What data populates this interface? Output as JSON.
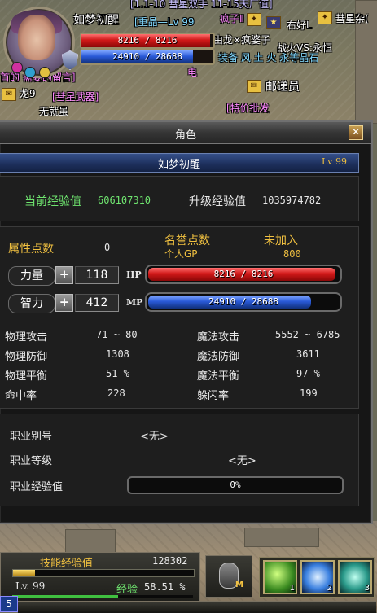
{
  "world": {
    "overhead_texts": [
      {
        "id": "guild_top",
        "text": "[1.1-10  彗星双手  11-15天厂值]",
        "cls": "npc-guild"
      },
      {
        "id": "shop_title1",
        "text": "[重晶—Lv 99",
        "cls": "npc-shop"
      },
      {
        "id": "mad_lady_line",
        "text": "疯子Ⅱ",
        "cls": "npc-title"
      },
      {
        "id": "right_good",
        "text": "右好L",
        "cls": "npc-name"
      },
      {
        "id": "comet_misc",
        "text": "彗星杂(",
        "cls": "npc-name"
      },
      {
        "id": "mad_lady",
        "text": "由龙×疯婆子",
        "cls": "npc-name"
      },
      {
        "id": "war_vs",
        "text": "战火VS:永恒",
        "cls": "npc-name"
      },
      {
        "id": "shop_items",
        "text": "装备  风  土  火  永等晶石",
        "cls": "npc-shop"
      },
      {
        "id": "message_board",
        "text": "首的   需要的留言]",
        "cls": "npc-title"
      },
      {
        "id": "electric",
        "text": "电 ",
        "cls": "npc-title"
      },
      {
        "id": "dragon9",
        "text": "龙9",
        "cls": "npc-name"
      },
      {
        "id": "comet_weapon",
        "text": "[彗星武器]",
        "cls": "npc-title"
      },
      {
        "id": "postman",
        "text": "邮递员",
        "cls": "npc-name"
      },
      {
        "id": "sale",
        "text": "[特价批发",
        "cls": "npc-title"
      },
      {
        "id": "no_shop",
        "text": "无就虽",
        "cls": "npc-name"
      }
    ]
  },
  "player": {
    "name": "如梦初醒",
    "hp_text": "8216 / 8216",
    "mp_text": "24910 / 28688",
    "hp_fraction": 1.0,
    "mp_fraction": 0.868
  },
  "window": {
    "title": "角色",
    "close_glyph": "✕",
    "char_name": "如梦初醒",
    "level": "Lv 99",
    "exp": {
      "current_label": "当前经验值",
      "current_value": "606107310",
      "next_label": "升级经验值",
      "next_value": "1035974782"
    },
    "points": {
      "attr_label": "属性点数",
      "attr_value": "0",
      "honor_label": "名誉点数",
      "honor_sub": "个人GP",
      "status_label": "未加入",
      "gp_value": "800"
    },
    "str": {
      "label": "力量",
      "value": "118",
      "bar_tag": "HP",
      "bar_text": "8216 / 8216",
      "fraction": 1.0
    },
    "int": {
      "label": "智力",
      "value": "412",
      "bar_tag": "MP",
      "bar_text": "24910 / 28688",
      "fraction": 0.868
    },
    "plus_glyph": "+",
    "combat": [
      {
        "l_label": "物理攻击",
        "l_value": "71 ~ 80",
        "r_label": "魔法攻击",
        "r_value": "5552 ~ 6785"
      },
      {
        "l_label": "物理防御",
        "l_value": "1308",
        "r_label": "魔法防御",
        "r_value": "3611"
      },
      {
        "l_label": "物理平衡",
        "l_value": "51 %",
        "r_label": "魔法平衡",
        "r_value": "97 %"
      },
      {
        "l_label": "命中率",
        "l_value": "228",
        "r_label": "躲闪率",
        "r_value": "199"
      }
    ],
    "job": {
      "alias_label": "职业别号",
      "alias_value": "<无>",
      "level_label": "职业等级",
      "level_value": "<无>",
      "exp_label": "职业经验值",
      "exp_value": "0%",
      "exp_fraction": 0.0
    }
  },
  "hud": {
    "skill_exp_label": "技能经验值",
    "skill_exp_value": "128302",
    "level": "Lv. 99",
    "exp_label": "经验",
    "exp_value": "58.51 %",
    "exp_fraction": 0.5851,
    "skill_exp_fraction": 0.12,
    "left_num": "5",
    "mouse_key": "M",
    "slot_numbers": [
      "1",
      "2",
      "3"
    ]
  },
  "colors": {
    "hp": "#d01818",
    "mp": "#2a5ad8",
    "label_green": "#6fe46f",
    "label_gold": "#f0c040"
  }
}
